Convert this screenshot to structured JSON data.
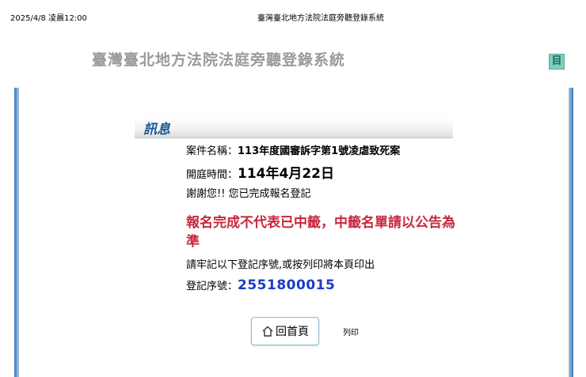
{
  "print_header": {
    "datetime": "2025/4/8 凌晨12:00",
    "title": "臺灣臺北地方法院法庭旁聽登錄系統"
  },
  "site": {
    "title": "臺灣臺北地方法院法庭旁聽登錄系統",
    "icon_glyph": "目"
  },
  "message": {
    "heading": "訊息",
    "case_label": "案件名稱：",
    "case_value": "113年度國審訴字第1號凌虐致死案",
    "date_label": "開庭時間：",
    "date_value": "114年4月22日",
    "thanks": "謝謝您!! 您已完成報名登記",
    "warning": "報名完成不代表已中籤，中籤名單請以公告為準",
    "remember": "請牢記以下登記序號,或按列印將本頁印出",
    "serial_label": "登記序號：",
    "serial_value": "2551800015"
  },
  "actions": {
    "home_label": "回首頁",
    "print_label": "列印"
  },
  "colors": {
    "heading": "#1e5a96",
    "warning": "#c8283c",
    "serial": "#1a3cc8",
    "rail": "#3a78b8"
  }
}
